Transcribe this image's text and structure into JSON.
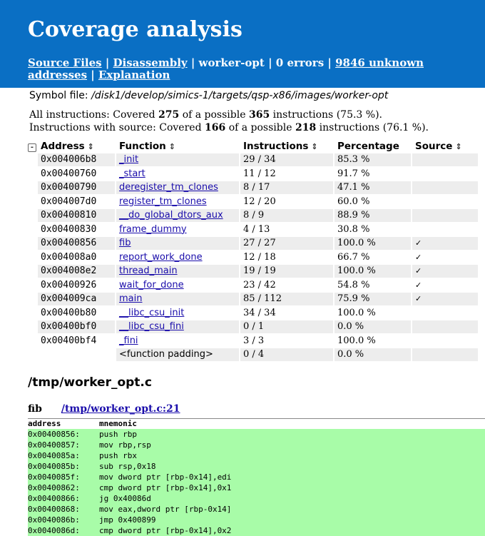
{
  "header": {
    "title": "Coverage analysis",
    "nav": {
      "source_files": "Source Files",
      "disassembly": "Disassembly",
      "binary": "worker-opt",
      "errors": "0 errors",
      "unknown": "9846 unknown addresses",
      "explanation": "Explanation",
      "sep": "|"
    }
  },
  "symbol_file": {
    "label": "Symbol file:",
    "path": "/disk1/develop/simics-1/targets/qsp-x86/images/worker-opt"
  },
  "stats": {
    "all": {
      "prefix": "All instructions: Covered",
      "covered": "275",
      "mid": "of a possible",
      "total": "365",
      "suffix": "instructions (75.3 %)."
    },
    "src": {
      "prefix": "Instructions with source: Covered",
      "covered": "166",
      "mid": "of a possible",
      "total": "218",
      "suffix": "instructions (76.1 %)."
    }
  },
  "table": {
    "collapse": "-",
    "headers": {
      "address": "Address",
      "function": "Function",
      "instructions": "Instructions",
      "percentage": "Percentage",
      "source": "Source",
      "sort": "⇕"
    },
    "rows": [
      {
        "address": "0x004006b8",
        "function": "_init",
        "instructions": "29 / 34",
        "percentage": "85.3 %",
        "source": ""
      },
      {
        "address": "0x00400760",
        "function": "_start",
        "instructions": "11 / 12",
        "percentage": "91.7 %",
        "source": ""
      },
      {
        "address": "0x00400790",
        "function": "deregister_tm_clones",
        "instructions": "8 / 17",
        "percentage": "47.1 %",
        "source": ""
      },
      {
        "address": "0x004007d0",
        "function": "register_tm_clones",
        "instructions": "12 / 20",
        "percentage": "60.0 %",
        "source": ""
      },
      {
        "address": "0x00400810",
        "function": "__do_global_dtors_aux",
        "instructions": "8 / 9",
        "percentage": "88.9 %",
        "source": ""
      },
      {
        "address": "0x00400830",
        "function": "frame_dummy",
        "instructions": "4 / 13",
        "percentage": "30.8 %",
        "source": ""
      },
      {
        "address": "0x00400856",
        "function": "fib",
        "instructions": "27 / 27",
        "percentage": "100.0 %",
        "source": "✓"
      },
      {
        "address": "0x004008a0",
        "function": "report_work_done",
        "instructions": "12 / 18",
        "percentage": "66.7 %",
        "source": "✓"
      },
      {
        "address": "0x004008e2",
        "function": "thread_main",
        "instructions": "19 / 19",
        "percentage": "100.0 %",
        "source": "✓"
      },
      {
        "address": "0x00400926",
        "function": "wait_for_done",
        "instructions": "23 / 42",
        "percentage": "54.8 %",
        "source": "✓"
      },
      {
        "address": "0x004009ca",
        "function": "main",
        "instructions": "85 / 112",
        "percentage": "75.9 %",
        "source": "✓"
      },
      {
        "address": "0x00400b80",
        "function": "__libc_csu_init",
        "instructions": "34 / 34",
        "percentage": "100.0 %",
        "source": ""
      },
      {
        "address": "0x00400bf0",
        "function": "__libc_csu_fini",
        "instructions": "0 / 1",
        "percentage": "0.0 %",
        "source": ""
      },
      {
        "address": "0x00400bf4",
        "function": "_fini",
        "instructions": "3 / 3",
        "percentage": "100.0 %",
        "source": ""
      },
      {
        "address": "",
        "function": "<function padding>",
        "instructions": "0 / 4",
        "percentage": "0.0 %",
        "source": "",
        "plain": true
      }
    ]
  },
  "source_file": "/tmp/worker_opt.c",
  "function_section": {
    "name": "fib",
    "link": "/tmp/worker_opt.c:21"
  },
  "disassembly": {
    "headers": {
      "address": "address",
      "mnemonic": "mnemonic"
    },
    "rows": [
      {
        "address": "0x00400856:",
        "mnemonic": "push rbp"
      },
      {
        "address": "0x00400857:",
        "mnemonic": "mov rbp,rsp"
      },
      {
        "address": "0x0040085a:",
        "mnemonic": "push rbx"
      },
      {
        "address": "0x0040085b:",
        "mnemonic": "sub rsp,0x18"
      },
      {
        "address": "0x0040085f:",
        "mnemonic": "mov dword ptr [rbp-0x14],edi"
      },
      {
        "address": "0x00400862:",
        "mnemonic": "cmp dword ptr [rbp-0x14],0x1"
      },
      {
        "address": "0x00400866:",
        "mnemonic": "jg 0x40086d"
      },
      {
        "address": "0x00400868:",
        "mnemonic": "mov eax,dword ptr [rbp-0x14]"
      },
      {
        "address": "0x0040086b:",
        "mnemonic": "jmp 0x400899"
      },
      {
        "address": "0x0040086d:",
        "mnemonic": "cmp dword ptr [rbp-0x14],0x2"
      }
    ]
  },
  "colors": {
    "header_bg": "#0a6fc4",
    "covered_bg": "#a8fca8",
    "row_alt": "#ededed"
  }
}
